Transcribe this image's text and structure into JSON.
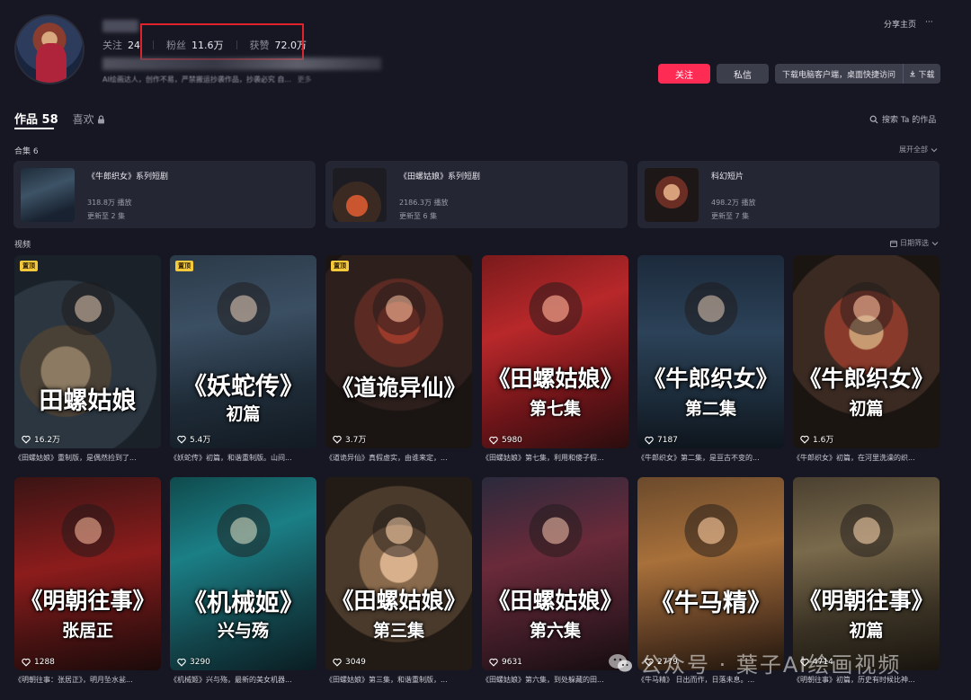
{
  "profile": {
    "follow_label": "关注",
    "follow_count": "24",
    "fans_label": "粉丝",
    "fans_count": "11.6万",
    "likes_label": "获赞",
    "likes_count": "72.0万",
    "bio": "AI绘画达人，创作不易，严禁搬运抄袭作品，抄袭必究 自...",
    "more": "更多"
  },
  "header": {
    "share": "分享主页",
    "more_icon": "···",
    "follow_button": "关注",
    "message_button": "私信",
    "download_text": "下载电脑客户端，桌面快捷访问",
    "download_button": "下载"
  },
  "tabs": {
    "works_label": "作品",
    "works_count": "58",
    "likes_label": "喜欢",
    "search": "搜索 Ta 的作品"
  },
  "collections": {
    "title": "合集 6",
    "expand": "展开全部",
    "items": [
      {
        "title": "《牛郎织女》系列短剧",
        "plays": "318.8万 播放",
        "update": "更新至 2 集"
      },
      {
        "title": "《田螺姑娘》系列短剧",
        "plays": "2186.3万 播放",
        "update": "更新至 6 集"
      },
      {
        "title": "科幻短片",
        "plays": "498.2万 播放",
        "update": "更新至 7 集"
      }
    ]
  },
  "videos_section": {
    "title": "视频",
    "filter": "日期筛选"
  },
  "videos": [
    {
      "title": "田螺姑娘",
      "sub": "",
      "pinned": "置顶",
      "likes": "16.2万",
      "desc": "《田螺姑娘》重制版，是偶然捡到了..."
    },
    {
      "title": "《妖蛇传》",
      "sub": "初篇",
      "pinned": "置顶",
      "likes": "5.4万",
      "desc": "《妖蛇传》初篇，和谐重制版。山间..."
    },
    {
      "title": "《道诡异仙》",
      "sub": "",
      "pinned": "置顶",
      "likes": "3.7万",
      "desc": "《道诡异仙》真假虚实，由谁来定，..."
    },
    {
      "title": "《田螺姑娘》",
      "sub": "第七集",
      "pinned": "",
      "likes": "5980",
      "desc": "《田螺姑娘》第七集，利用和傻子假..."
    },
    {
      "title": "《牛郎织女》",
      "sub": "第二集",
      "pinned": "",
      "likes": "7187",
      "desc": "《牛郎织女》第二集，是亘古不变的..."
    },
    {
      "title": "《牛郎织女》",
      "sub": "初篇",
      "pinned": "",
      "likes": "1.6万",
      "desc": "《牛郎织女》初篇，在河里洗澡的织..."
    },
    {
      "title": "《明朝往事》",
      "sub": "张居正",
      "pinned": "",
      "likes": "1288",
      "desc": "《明朝往事：张居正》，明月坠水瓮..."
    },
    {
      "title": "《机械姬》",
      "sub": "兴与殇",
      "pinned": "",
      "likes": "3290",
      "desc": "《机械姬》兴与殇，最新的美女机器..."
    },
    {
      "title": "《田螺姑娘》",
      "sub": "第三集",
      "pinned": "",
      "likes": "3049",
      "desc": "《田螺姑娘》第三集，和谐重制版，..."
    },
    {
      "title": "《田螺姑娘》",
      "sub": "第六集",
      "pinned": "",
      "likes": "9631",
      "desc": "《田螺姑娘》第六集，到处躲藏的田..."
    },
    {
      "title": "《牛马精》",
      "sub": "",
      "pinned": "",
      "likes": "2779",
      "desc": "《牛马精》 日出而作，日落未息。..."
    },
    {
      "title": "《明朝往事》",
      "sub": "初篇",
      "pinned": "",
      "likes": "4714",
      "desc": "《明朝往事》初篇，历史有时候比神..."
    }
  ],
  "watermark": "公众号 · 葉子AI绘画视频",
  "colors": {
    "background": "#161722",
    "accent": "#fe2c55",
    "highlight": "#e0232b",
    "pin": "#f6c93b",
    "card": "#252634"
  }
}
